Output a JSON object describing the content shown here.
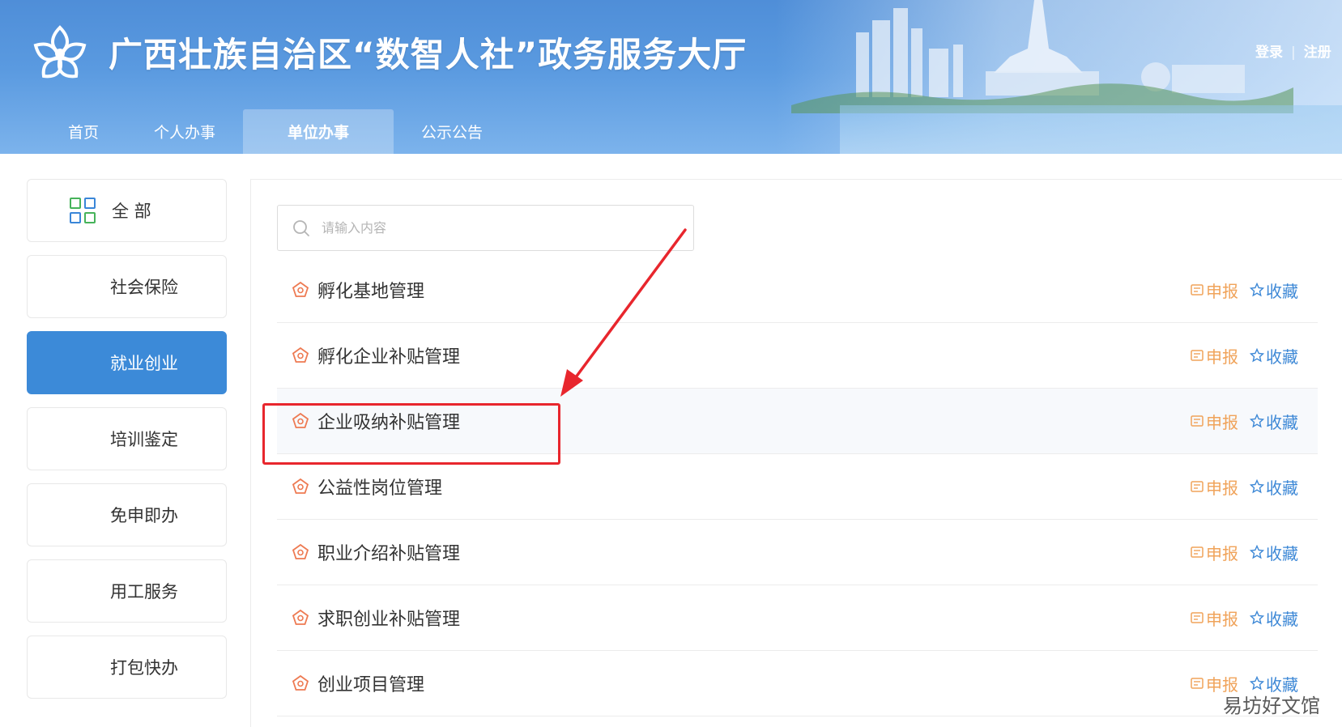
{
  "header": {
    "site_title": "广西壮族自治区“数智人社”政务服务大厅",
    "login": "登录",
    "separator": "|",
    "register": "注册",
    "nav": [
      {
        "label": "首页",
        "active": false
      },
      {
        "label": "个人办事",
        "active": false
      },
      {
        "label": "单位办事",
        "active": true
      },
      {
        "label": "公示公告",
        "active": false
      }
    ]
  },
  "sidebar": {
    "items": [
      {
        "label": "全 部",
        "icon": "grid-icon",
        "active": false
      },
      {
        "label": "社会保险",
        "active": false
      },
      {
        "label": "就业创业",
        "active": true
      },
      {
        "label": "培训鉴定",
        "active": false
      },
      {
        "label": "免申即办",
        "active": false
      },
      {
        "label": "用工服务",
        "active": false
      },
      {
        "label": "打包快办",
        "active": false
      }
    ]
  },
  "search": {
    "placeholder": "请输入内容",
    "value": ""
  },
  "services": {
    "apply_label": "申报",
    "favorite_label": "收藏",
    "items": [
      {
        "title": "孵化基地管理"
      },
      {
        "title": "孵化企业补贴管理"
      },
      {
        "title": "企业吸纳补贴管理",
        "highlighted": true
      },
      {
        "title": "公益性岗位管理"
      },
      {
        "title": "职业介绍补贴管理"
      },
      {
        "title": "求职创业补贴管理"
      },
      {
        "title": "创业项目管理"
      }
    ]
  },
  "colors": {
    "header_blue": "#5a9ae0",
    "active_blue": "#3c8ad8",
    "apply_orange": "#f0a35a",
    "favorite_blue": "#3d88d6",
    "annotation_red": "#e8262d"
  },
  "watermark": "易坊好文馆"
}
